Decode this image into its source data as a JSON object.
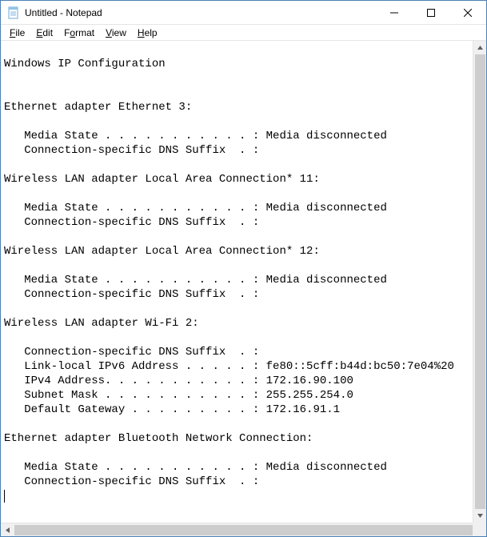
{
  "titlebar": {
    "title": "Untitled - Notepad"
  },
  "menu": {
    "file": "File",
    "edit": "Edit",
    "format": "Format",
    "view": "View",
    "help": "Help"
  },
  "content": {
    "lines": [
      "",
      "Windows IP Configuration",
      "",
      "",
      "Ethernet adapter Ethernet 3:",
      "",
      "   Media State . . . . . . . . . . . : Media disconnected",
      "   Connection-specific DNS Suffix  . :",
      "",
      "Wireless LAN adapter Local Area Connection* 11:",
      "",
      "   Media State . . . . . . . . . . . : Media disconnected",
      "   Connection-specific DNS Suffix  . :",
      "",
      "Wireless LAN adapter Local Area Connection* 12:",
      "",
      "   Media State . . . . . . . . . . . : Media disconnected",
      "   Connection-specific DNS Suffix  . :",
      "",
      "Wireless LAN adapter Wi-Fi 2:",
      "",
      "   Connection-specific DNS Suffix  . :",
      "   Link-local IPv6 Address . . . . . : fe80::5cff:b44d:bc50:7e04%20",
      "   IPv4 Address. . . . . . . . . . . : 172.16.90.100",
      "   Subnet Mask . . . . . . . . . . . : 255.255.254.0",
      "   Default Gateway . . . . . . . . . : 172.16.91.1",
      "",
      "Ethernet adapter Bluetooth Network Connection:",
      "",
      "   Media State . . . . . . . . . . . : Media disconnected",
      "   Connection-specific DNS Suffix  . :"
    ]
  }
}
